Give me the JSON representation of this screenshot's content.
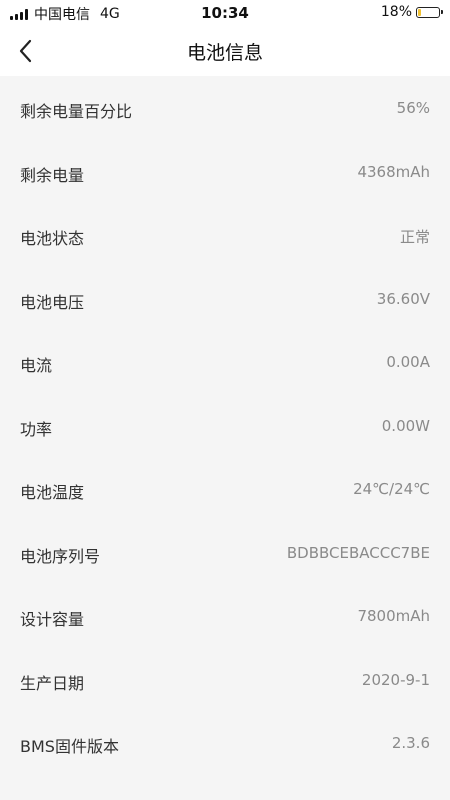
{
  "status_bar": {
    "carrier": "中国电信",
    "network": "4G",
    "time": "10:34",
    "battery_percent": "18%",
    "battery_level": 0.18,
    "battery_color": "#f1c232"
  },
  "nav": {
    "back_icon": "chevron-left-icon",
    "title": "电池信息"
  },
  "rows": [
    {
      "label": "剩余电量百分比",
      "value": "56%"
    },
    {
      "label": "剩余电量",
      "value": "4368mAh"
    },
    {
      "label": "电池状态",
      "value": "正常"
    },
    {
      "label": "电池电压",
      "value": "36.60V"
    },
    {
      "label": "电流",
      "value": "0.00A"
    },
    {
      "label": "功率",
      "value": "0.00W"
    },
    {
      "label": "电池温度",
      "value": "24℃/24℃"
    },
    {
      "label": "电池序列号",
      "value": "BDBBCEBACCC7BE"
    },
    {
      "label": "设计容量",
      "value": "7800mAh"
    },
    {
      "label": "生产日期",
      "value": "2020-9-1"
    },
    {
      "label": "BMS固件版本",
      "value": "2.3.6"
    }
  ]
}
